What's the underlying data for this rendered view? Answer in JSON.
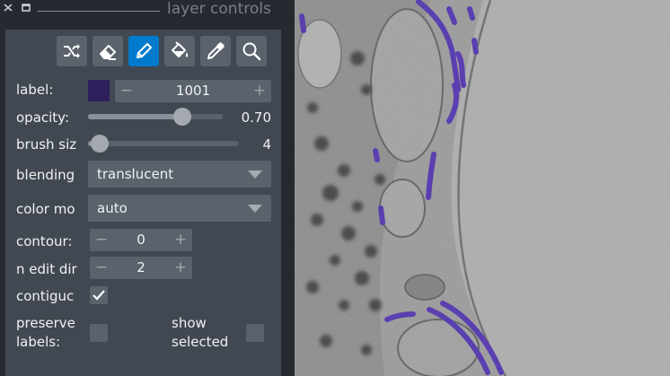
{
  "title_bar": {
    "title": "layer controls",
    "close_icon": "close-icon",
    "float_icon": "float-icon"
  },
  "toolbar": {
    "tools": [
      {
        "icon": "shuffle-icon",
        "active": false
      },
      {
        "icon": "eraser-icon",
        "active": false
      },
      {
        "icon": "paint-brush-icon",
        "active": true
      },
      {
        "icon": "fill-bucket-icon",
        "active": false
      },
      {
        "icon": "color-picker-icon",
        "active": false
      },
      {
        "icon": "magnifier-icon",
        "active": false
      }
    ]
  },
  "controls": {
    "label": {
      "name": "label:",
      "value": "1001",
      "swatch_color": "#2e1f5c",
      "minus": "−",
      "plus": "+"
    },
    "opacity": {
      "name": "opacity:",
      "value": "0.70",
      "fraction": 0.7
    },
    "brush_size": {
      "name": "brush siz",
      "value": "4",
      "fraction": 0.08
    },
    "blending": {
      "name": "blending",
      "value": "translucent"
    },
    "color_mode": {
      "name": "color mo",
      "value": "auto"
    },
    "contour": {
      "name": "contour:",
      "value": "0",
      "minus": "−",
      "plus": "+"
    },
    "n_edit_dim": {
      "name": "n edit dir",
      "value": "2",
      "minus": "−",
      "plus": "+"
    },
    "contiguous": {
      "name": "contiguc",
      "checked": true
    },
    "preserve_labels": {
      "name_line1": "preserve",
      "name_line2": "labels:",
      "checked": false
    },
    "show_selected": {
      "name_line1": "show",
      "name_line2": "selected",
      "checked": false
    }
  },
  "colors": {
    "panel_bg": "#262930",
    "content_bg": "#414851",
    "widget_bg": "#5a626c",
    "accent": "#007acc",
    "label_paint": "#5b3fb0"
  }
}
